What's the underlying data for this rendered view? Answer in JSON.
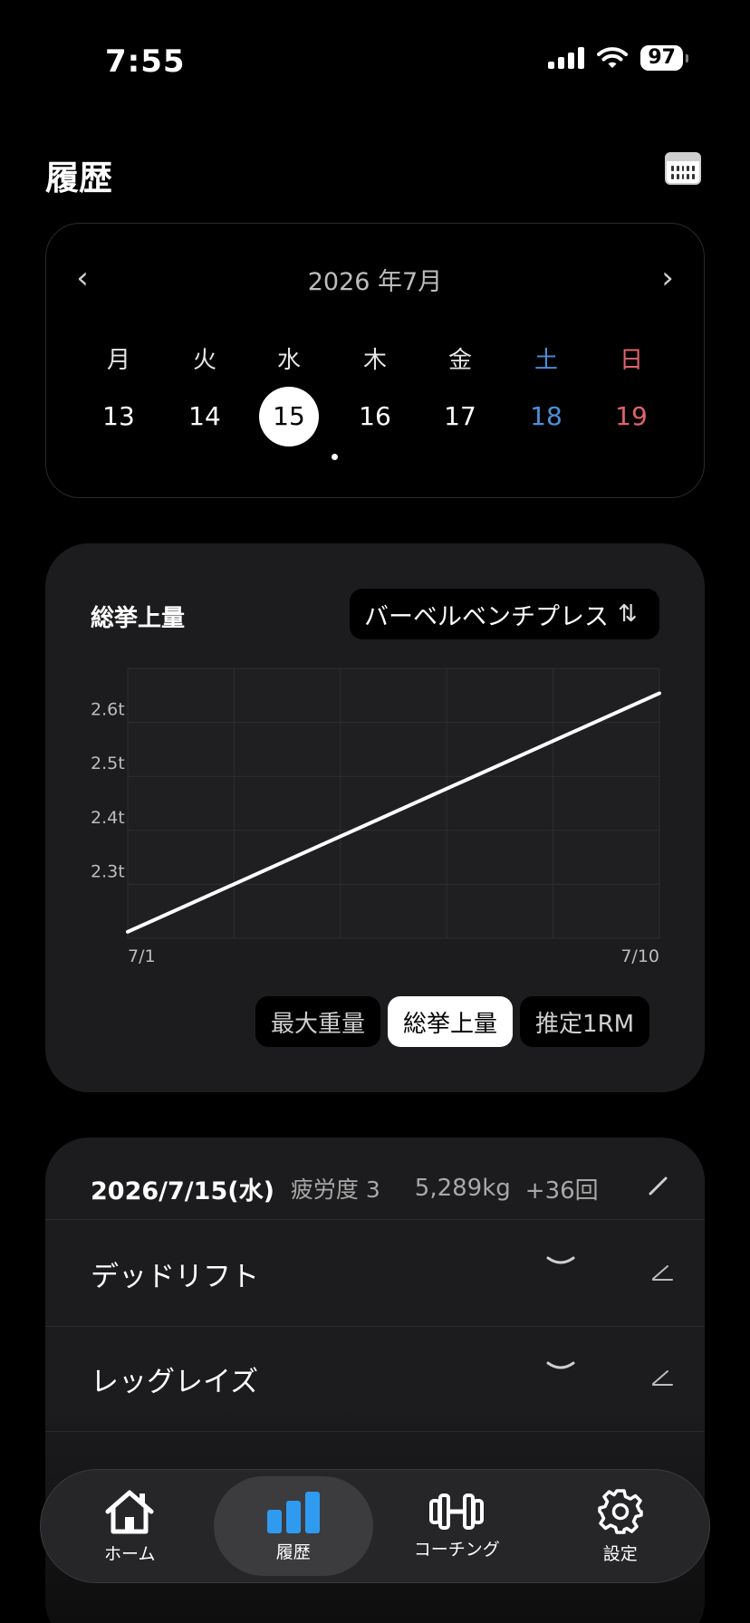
{
  "status_bar": {
    "time": "7:55",
    "battery": "97"
  },
  "header": {
    "title": "履歴"
  },
  "week": {
    "month_label": "2026 年7月",
    "prev": "‹",
    "next": "›",
    "weekdays": [
      "月",
      "火",
      "水",
      "木",
      "金",
      "土",
      "日"
    ],
    "days": [
      "13",
      "14",
      "15",
      "16",
      "17",
      "18",
      "19"
    ],
    "selected_index": 2
  },
  "chart_card": {
    "title": "総挙上量",
    "exercise": "バーベルベンチプレス",
    "sort_glyph": "⇅",
    "tabs": [
      {
        "label": "最大重量",
        "active": false
      },
      {
        "label": "総挙上量",
        "active": true
      },
      {
        "label": "推定1RM",
        "active": false
      }
    ]
  },
  "chart_data": {
    "type": "line",
    "title": "",
    "xlabel": "",
    "ylabel": "",
    "x": [
      "7/1",
      "7/10"
    ],
    "x_tick_labels": [
      "7/1",
      "7/10"
    ],
    "y_tick_labels": [
      "2.3t",
      "2.4t",
      "2.5t",
      "2.6t"
    ],
    "y_ticks": [
      2.3,
      2.4,
      2.5,
      2.6
    ],
    "ylim": [
      2.2,
      2.7
    ],
    "values": [
      2.212,
      2.654
    ],
    "grid": true,
    "line_color": "#ffffff"
  },
  "log": {
    "date": "2026/7/15(水)",
    "fatigue": "疲労度 3",
    "total_volume": "5,289kg",
    "total_reps": "+36回",
    "exercises": [
      {
        "name": "デッドリフト"
      },
      {
        "name": "レッグレイズ"
      }
    ]
  },
  "tab_bar": {
    "items": [
      {
        "label": "ホーム",
        "icon": "home-icon",
        "active": false
      },
      {
        "label": "履歴",
        "icon": "bar-chart-icon",
        "active": true
      },
      {
        "label": "コーチング",
        "icon": "dumbbell-icon",
        "active": false
      },
      {
        "label": "設定",
        "icon": "gear-icon",
        "active": false
      }
    ]
  },
  "colors": {
    "accent": "#2f9bf0",
    "saturday": "#4a90d9",
    "sunday": "#e0636b",
    "card": "#1c1c1e"
  }
}
